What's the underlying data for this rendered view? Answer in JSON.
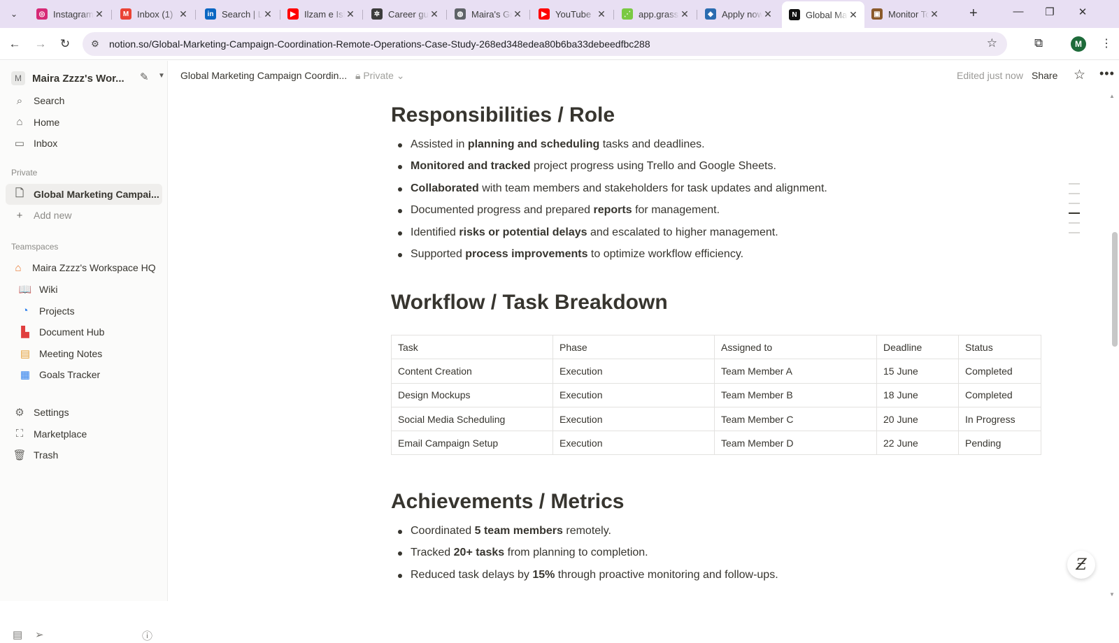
{
  "browser": {
    "tabs": [
      {
        "label": "Instagram",
        "icon": "instagram-icon",
        "color": "#d62976",
        "glyph": "◎"
      },
      {
        "label": "Inbox (1)",
        "icon": "gmail-icon",
        "color": "#ea4335",
        "glyph": "M"
      },
      {
        "label": "Search | LinkedIn",
        "icon": "linkedin-icon",
        "color": "#0a66c2",
        "glyph": "in"
      },
      {
        "label": "Ilzam e Ishq",
        "icon": "youtube-icon",
        "color": "#ff0000",
        "glyph": "▶"
      },
      {
        "label": "Career guidance",
        "icon": "chatgpt-icon",
        "color": "#3c3c3c",
        "glyph": "✲"
      },
      {
        "label": "Maira's Gmail",
        "icon": "globe-icon",
        "color": "#5f6368",
        "glyph": "◍"
      },
      {
        "label": "YouTube",
        "icon": "youtube-icon",
        "color": "#ff0000",
        "glyph": "▶"
      },
      {
        "label": "app.grass.io",
        "icon": "grass-icon",
        "color": "#7ac943",
        "glyph": "⋰"
      },
      {
        "label": "Apply now",
        "icon": "diamond-icon",
        "color": "#2b6cb0",
        "glyph": "◆"
      },
      {
        "label": "Global Marketing",
        "icon": "notion-icon",
        "color": "#111111",
        "glyph": "N"
      },
      {
        "label": "Monitor Tools",
        "icon": "monitor-icon",
        "color": "#8b5a2b",
        "glyph": "▣"
      }
    ],
    "url": "notion.so/Global-Marketing-Campaign-Coordination-Remote-Operations-Case-Study-268ed348edea80b6ba33debeedfbc288",
    "profile_initial": "M"
  },
  "sidebar": {
    "workspace_initial": "M",
    "workspace_name": "Maira Zzzz's Wor...",
    "nav": [
      {
        "label": "Search",
        "icon": "search-icon",
        "glyph": "⌕"
      },
      {
        "label": "Home",
        "icon": "home-icon",
        "glyph": "⌂"
      },
      {
        "label": "Inbox",
        "icon": "inbox-icon",
        "glyph": "▭"
      }
    ],
    "private_heading": "Private",
    "private_page": "Global Marketing Campai...",
    "add_new": "Add new",
    "teamspaces_heading": "Teamspaces",
    "teamspace_name": "Maira Zzzz's Workspace HQ",
    "team_pages": [
      {
        "label": "Wiki",
        "icon": "book-icon",
        "glyph": "📖",
        "color": "#8c8b87"
      },
      {
        "label": "Projects",
        "icon": "projects-icon",
        "glyph": "◔",
        "color": "#2f80ed"
      },
      {
        "label": "Document Hub",
        "icon": "document-icon",
        "glyph": "▙",
        "color": "#e03e3e"
      },
      {
        "label": "Meeting Notes",
        "icon": "calendar-icon",
        "glyph": "▤",
        "color": "#e5a13a"
      },
      {
        "label": "Goals Tracker",
        "icon": "goals-icon",
        "glyph": "▦",
        "color": "#2f80ed"
      }
    ],
    "footer": [
      {
        "label": "Settings",
        "icon": "gear-icon",
        "glyph": "⚙"
      },
      {
        "label": "Marketplace",
        "icon": "marketplace-icon",
        "glyph": "⛶"
      },
      {
        "label": "Trash",
        "icon": "trash-icon",
        "glyph": "🗑"
      }
    ]
  },
  "topbar": {
    "breadcrumb": "Global Marketing Campaign Coordin...",
    "privacy": "Private",
    "edited": "Edited just now",
    "share": "Share"
  },
  "content": {
    "responsibilities": {
      "heading": "Responsibilities / Role",
      "items": [
        [
          {
            "t": "Assisted in "
          },
          {
            "b": "planning and scheduling"
          },
          {
            "t": " tasks and deadlines."
          }
        ],
        [
          {
            "b": "Monitored and tracked"
          },
          {
            "t": " project progress using Trello and Google Sheets."
          }
        ],
        [
          {
            "b": "Collaborated"
          },
          {
            "t": " with team members and stakeholders for task updates and alignment."
          }
        ],
        [
          {
            "t": "Documented progress and prepared "
          },
          {
            "b": "reports"
          },
          {
            "t": " for management."
          }
        ],
        [
          {
            "t": "Identified "
          },
          {
            "b": "risks or potential delays"
          },
          {
            "t": " and escalated to higher management."
          }
        ],
        [
          {
            "t": "Supported "
          },
          {
            "b": "process improvements"
          },
          {
            "t": " to optimize workflow efficiency."
          }
        ]
      ]
    },
    "workflow": {
      "heading": "Workflow / Task Breakdown",
      "columns": [
        "Task",
        "Phase",
        "Assigned to",
        "Deadline",
        "Status"
      ],
      "rows": [
        [
          "Content Creation",
          "Execution",
          "Team Member A",
          "15 June",
          "Completed"
        ],
        [
          "Design Mockups",
          "Execution",
          "Team Member B",
          "18 June",
          "Completed"
        ],
        [
          "Social Media Scheduling",
          "Execution",
          "Team Member C",
          "20 June",
          "In Progress"
        ],
        [
          "Email Campaign Setup",
          "Execution",
          "Team Member D",
          "22 June",
          "Pending"
        ]
      ]
    },
    "achievements": {
      "heading": "Achievements / Metrics",
      "items": [
        [
          {
            "t": "Coordinated "
          },
          {
            "b": "5 team members"
          },
          {
            "t": " remotely."
          }
        ],
        [
          {
            "t": "Tracked "
          },
          {
            "b": "20+ tasks"
          },
          {
            "t": " from planning to completion."
          }
        ],
        [
          {
            "t": "Reduced task delays by "
          },
          {
            "b": "15%"
          },
          {
            "t": " through proactive monitoring and follow-ups."
          }
        ]
      ]
    }
  }
}
